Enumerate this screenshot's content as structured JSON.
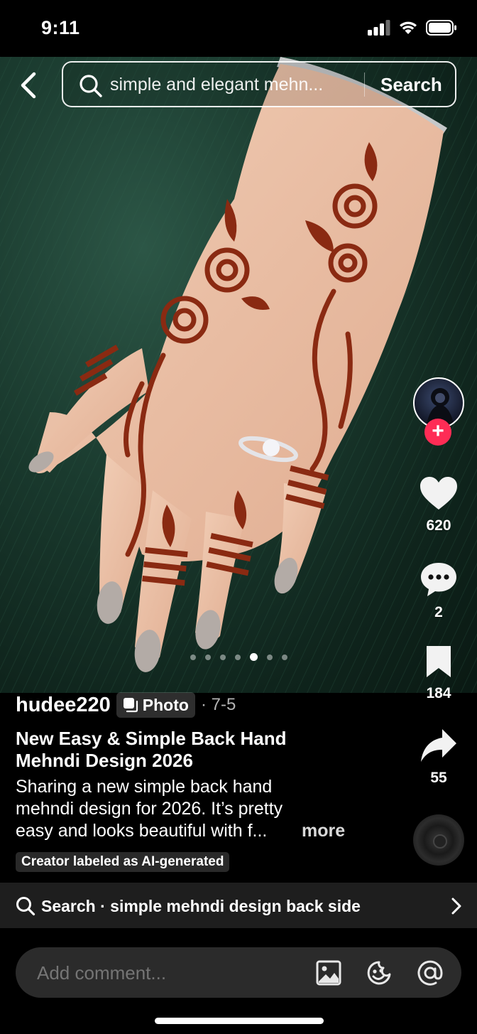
{
  "status_bar": {
    "time": "9:11"
  },
  "search": {
    "query": "simple and elegant mehn...",
    "button_label": "Search"
  },
  "post": {
    "username": "hudee220",
    "type_badge": "Photo",
    "date": "· 7-5",
    "title": "New Easy & Simple Back Hand\nMehndi Design 2026",
    "body": "Sharing a new simple back hand\nmehndi design for 2026. It’s pretty\neasy and looks beautiful with f...",
    "more_label": "more",
    "ai_label": "Creator labeled as AI-generated",
    "photo_count": 7,
    "active_photo_index": 4
  },
  "actions": {
    "likes": "620",
    "comments": "2",
    "saves": "184",
    "shares": "55",
    "follow_symbol": "+"
  },
  "related_search": {
    "label": "Search · simple mehndi design back side"
  },
  "comment_bar": {
    "placeholder": "Add comment..."
  },
  "icons": {
    "back": "chevron-left-icon",
    "search": "search-icon",
    "like": "heart-icon",
    "comment": "comment-bubble-icon",
    "save": "bookmark-icon",
    "share": "share-arrow-icon",
    "image": "image-icon",
    "emoji": "emoji-icon",
    "mention": "at-icon"
  },
  "colors": {
    "follow_accent": "#fe2c55",
    "background": "#000000",
    "fur_green": "#1a3a2e",
    "henna": "#8a2a12"
  }
}
